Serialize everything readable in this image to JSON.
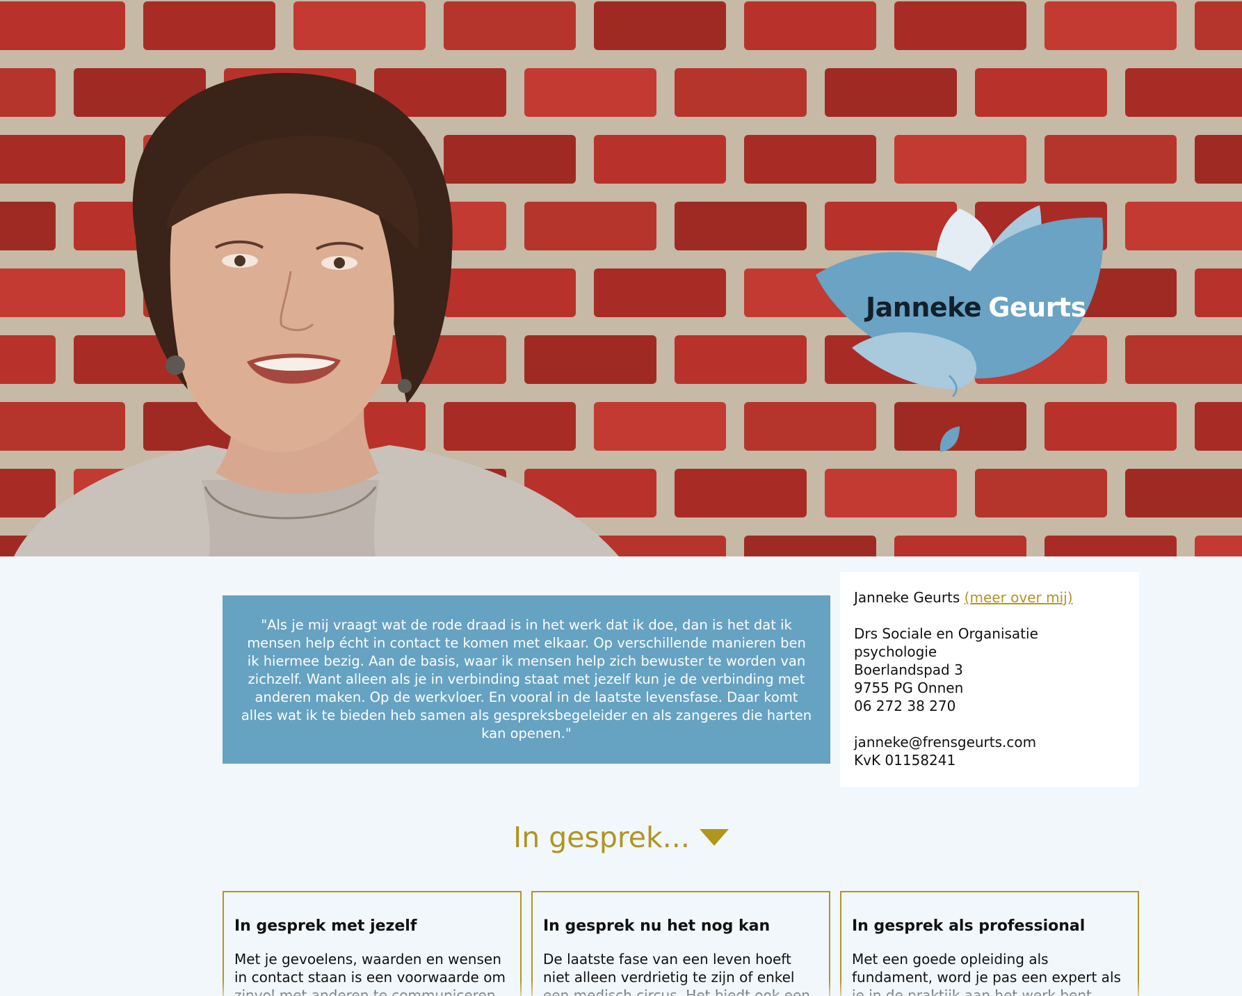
{
  "hero": {
    "logo": {
      "first_name": "Janneke",
      "last_name": "Geurts",
      "colors": {
        "petal": "#6aa3c3",
        "petal_light": "#a9c9dc",
        "petal_white": "#e3edf3"
      }
    },
    "wall_colors": {
      "brick": "#b8322b",
      "mortar": "#c7bba9"
    }
  },
  "quote": {
    "text": "\"Als je mij vraagt wat de rode draad is in het werk dat ik doe, dan is het dat ik mensen help écht in contact te komen met elkaar. Op verschillende manieren ben ik hiermee bezig. Aan de basis, waar ik mensen help zich bewuster te worden van zichzelf. Want alleen als je in verbinding staat met jezelf kun je de verbinding met anderen maken. Op de werkvloer. En vooral in de laatste levensfase. Daar komt alles wat ik te bieden heb samen als gespreksbegeleider en als zangeres die harten kan openen.\"",
    "background": "#66a2c2"
  },
  "contact": {
    "name": "Janneke Geurts",
    "more_link": "(meer over mij)",
    "title_line1": "Drs Sociale en Organisatie",
    "title_line2": "psychologie",
    "street": "Boerlandspad 3",
    "city": "9755 PG Onnen",
    "phone": "06 272 38 270",
    "email": "janneke@frensgeurts.com",
    "kvk": "KvK 01158241"
  },
  "section": {
    "heading": "In gesprek...",
    "accent": "#b0951f"
  },
  "cards": [
    {
      "title": "In gesprek met jezelf",
      "text": "Met je gevoelens, waarden en wensen in contact staan is een voorwaarde om zinvol met anderen te communiceren."
    },
    {
      "title": "In gesprek nu het nog kan",
      "text": "De laatste fase van een leven hoeft niet alleen verdrietig te zijn of enkel een medisch circus. Het biedt ook een kans."
    },
    {
      "title": "In gesprek als professional",
      "text": "Met een goede opleiding als fundament, word je pas een expert als je in de praktijk aan het werk bent."
    }
  ]
}
